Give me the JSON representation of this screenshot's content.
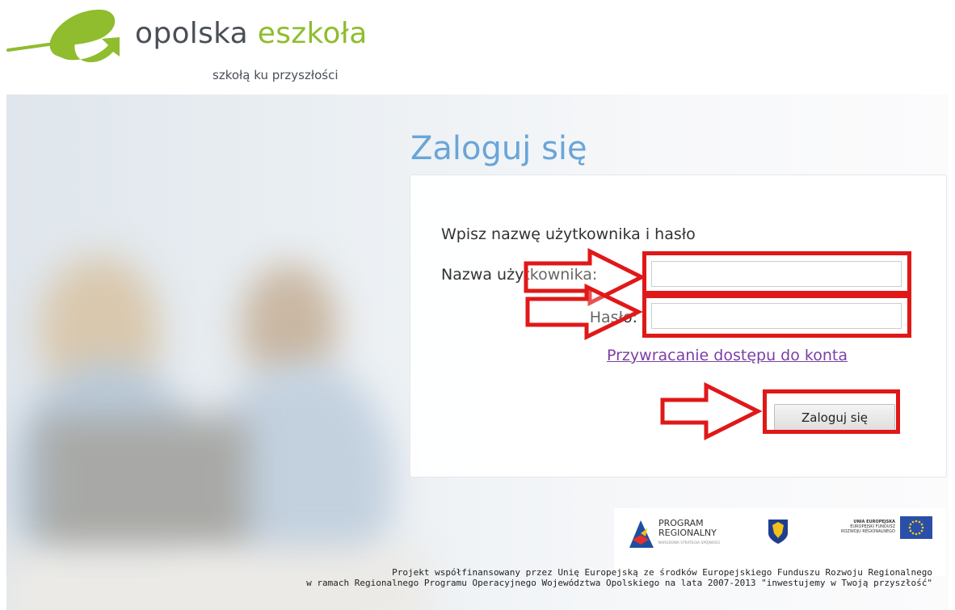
{
  "brand": {
    "name_part1": "opolska ",
    "name_part2": "eszkoła",
    "tagline": "szkołą ku przyszłości",
    "green": "#8fbd2e",
    "dark": "#4a4f57"
  },
  "login": {
    "title": "Zaloguj się",
    "intro": "Wpisz nazwę użytkownika i hasło",
    "username_label": "Nazwa użytkownika:",
    "password_label": "Hasło:",
    "username_value": "",
    "password_value": "",
    "recover_link": "Przywracanie dostępu do konta",
    "submit_label": "Zaloguj się",
    "title_color": "#6aa5d8",
    "link_color": "#7b3fa5"
  },
  "annotations": {
    "color": "#e01818",
    "arrow_icon": "arrow-right-icon"
  },
  "funding": {
    "program_line1": "PROGRAM",
    "program_line2": "REGIONALNY",
    "program_line3": "NARODOWA STRATEGIA SPÓJNOŚCI",
    "eu_line1": "UNIA EUROPEJSKA",
    "eu_line2": "EUROPEJSKI FUNDUSZ",
    "eu_line3": "ROZWOJU REGIONALNEGO",
    "footer_line1": "Projekt współfinansowany przez Unię Europejską ze środków Europejskiego Funduszu Rozwoju Regionalnego",
    "footer_line2": "w ramach Regionalnego Programu Operacyjnego Województwa Opolskiego na lata 2007-2013 \"inwestujemy w Twoją przyszłość\""
  }
}
